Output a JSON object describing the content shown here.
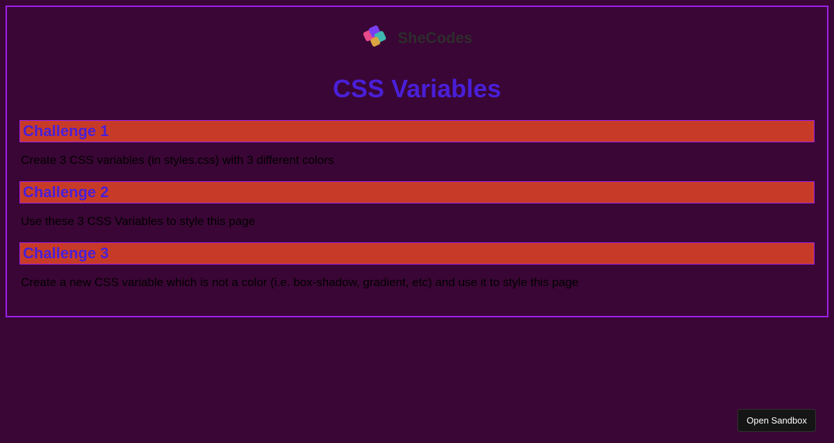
{
  "header": {
    "brand": "SheCodes",
    "title": "CSS Variables"
  },
  "challenges": [
    {
      "heading": "Challenge 1",
      "body": "Create 3 CSS variables (in styles.css) with 3 different colors"
    },
    {
      "heading": "Challenge 2",
      "body": "Use these 3 CSS Variables to style this page"
    },
    {
      "heading": "Challenge 3",
      "body": "Create a new CSS variable which is not a color (i.e. box-shadow, gradient, etc) and use it to style this page"
    }
  ],
  "footer": {
    "sandbox_button": "Open Sandbox"
  }
}
